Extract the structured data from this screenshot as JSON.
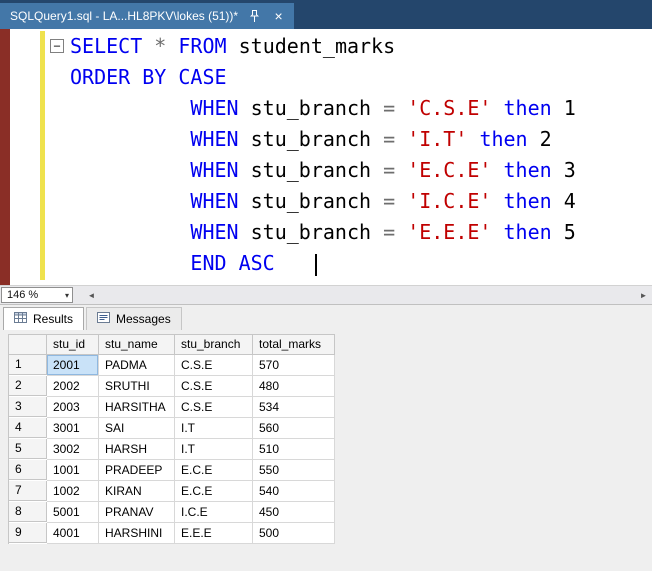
{
  "colors": {
    "tabbar-bg": "#24466C",
    "tab-active-bg": "#4377A8",
    "margin-red": "#8A2E26",
    "margin-yellow": "#EFE24D",
    "kw": "#0000F0",
    "str": "#C00000",
    "op": "#6E6E6E",
    "cell-selected": "#C9E2F8"
  },
  "doc_tab": {
    "title": "SQLQuery1.sql - LA...HL8PKV\\lokes (51))*",
    "close_glyph": "×"
  },
  "editor": {
    "collapse_glyph": "−",
    "zoom_value": "146 %",
    "zoom_arrow_glyph": "▾",
    "scroll_left_glyph": "◄",
    "scroll_right_glyph": "►",
    "lines": [
      {
        "tokens": [
          {
            "t": "SELECT ",
            "c": "kw"
          },
          {
            "t": "* ",
            "c": "op"
          },
          {
            "t": "FROM ",
            "c": "kw"
          },
          {
            "t": "student_marks",
            "c": "id"
          }
        ]
      },
      {
        "tokens": [
          {
            "t": "ORDER BY CASE",
            "c": "kw"
          }
        ]
      },
      {
        "tokens": [
          {
            "t": "          ",
            "c": "pl"
          },
          {
            "t": "WHEN ",
            "c": "kw"
          },
          {
            "t": "stu_branch ",
            "c": "id"
          },
          {
            "t": "= ",
            "c": "op"
          },
          {
            "t": "'C.S.E' ",
            "c": "str"
          },
          {
            "t": "then ",
            "c": "kw"
          },
          {
            "t": "1",
            "c": "num"
          }
        ]
      },
      {
        "tokens": [
          {
            "t": "          ",
            "c": "pl"
          },
          {
            "t": "WHEN ",
            "c": "kw"
          },
          {
            "t": "stu_branch ",
            "c": "id"
          },
          {
            "t": "= ",
            "c": "op"
          },
          {
            "t": "'I.T' ",
            "c": "str"
          },
          {
            "t": "then ",
            "c": "kw"
          },
          {
            "t": "2",
            "c": "num"
          }
        ]
      },
      {
        "tokens": [
          {
            "t": "          ",
            "c": "pl"
          },
          {
            "t": "WHEN ",
            "c": "kw"
          },
          {
            "t": "stu_branch ",
            "c": "id"
          },
          {
            "t": "= ",
            "c": "op"
          },
          {
            "t": "'E.C.E' ",
            "c": "str"
          },
          {
            "t": "then ",
            "c": "kw"
          },
          {
            "t": "3",
            "c": "num"
          }
        ]
      },
      {
        "tokens": [
          {
            "t": "          ",
            "c": "pl"
          },
          {
            "t": "WHEN ",
            "c": "kw"
          },
          {
            "t": "stu_branch ",
            "c": "id"
          },
          {
            "t": "= ",
            "c": "op"
          },
          {
            "t": "'I.C.E' ",
            "c": "str"
          },
          {
            "t": "then ",
            "c": "kw"
          },
          {
            "t": "4",
            "c": "num"
          }
        ]
      },
      {
        "tokens": [
          {
            "t": "          ",
            "c": "pl"
          },
          {
            "t": "WHEN ",
            "c": "kw"
          },
          {
            "t": "stu_branch ",
            "c": "id"
          },
          {
            "t": "= ",
            "c": "op"
          },
          {
            "t": "'E.E.E' ",
            "c": "str"
          },
          {
            "t": "then ",
            "c": "kw"
          },
          {
            "t": "5",
            "c": "num"
          }
        ]
      },
      {
        "tokens": [
          {
            "t": "          ",
            "c": "pl"
          },
          {
            "t": "END ASC",
            "c": "kw"
          }
        ],
        "caret": true
      }
    ]
  },
  "results": {
    "tabs": [
      {
        "label": "Results"
      },
      {
        "label": "Messages"
      }
    ],
    "grid": {
      "columns": [
        "stu_id",
        "stu_name",
        "stu_branch",
        "total_marks"
      ],
      "rows": [
        {
          "n": "1",
          "cells": [
            "2001",
            "PADMA",
            "C.S.E",
            "570"
          ]
        },
        {
          "n": "2",
          "cells": [
            "2002",
            "SRUTHI",
            "C.S.E",
            "480"
          ]
        },
        {
          "n": "3",
          "cells": [
            "2003",
            "HARSITHA",
            "C.S.E",
            "534"
          ]
        },
        {
          "n": "4",
          "cells": [
            "3001",
            "SAI",
            "I.T",
            "560"
          ]
        },
        {
          "n": "5",
          "cells": [
            "3002",
            "HARSH",
            "I.T",
            "510"
          ]
        },
        {
          "n": "6",
          "cells": [
            "1001",
            "PRADEEP",
            "E.C.E",
            "550"
          ]
        },
        {
          "n": "7",
          "cells": [
            "1002",
            "KIRAN",
            "E.C.E",
            "540"
          ]
        },
        {
          "n": "8",
          "cells": [
            "5001",
            "PRANAV",
            "I.C.E",
            "450"
          ]
        },
        {
          "n": "9",
          "cells": [
            "4001",
            "HARSHINI",
            "E.E.E",
            "500"
          ]
        }
      ],
      "selected": {
        "row": 0,
        "col": 0
      }
    }
  }
}
